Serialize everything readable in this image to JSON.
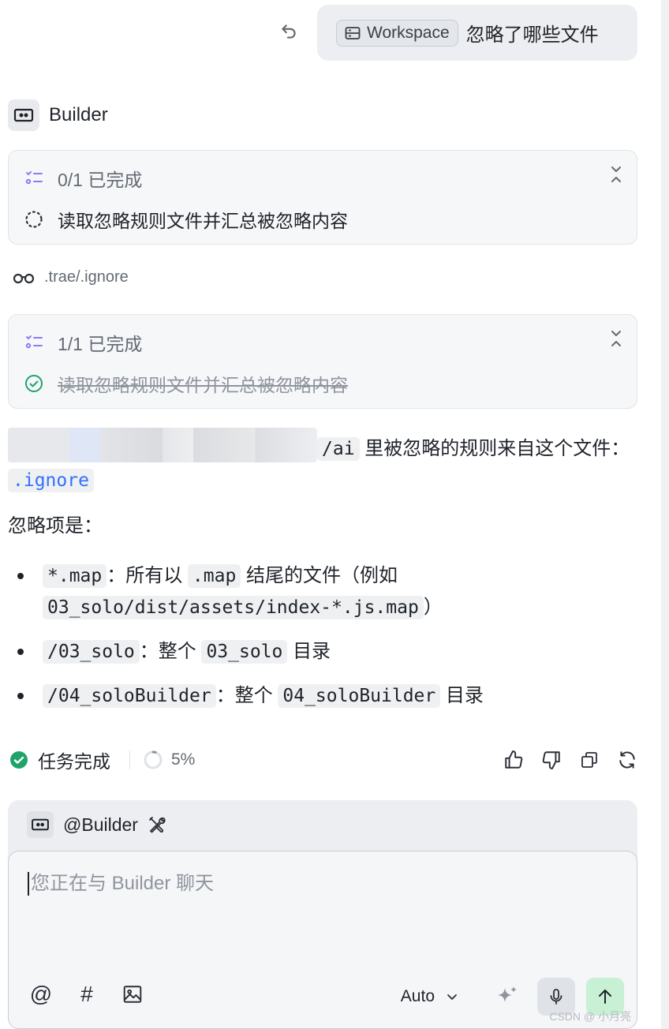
{
  "user_message": {
    "workspace_chip": "Workspace",
    "text": "忽略了哪些文件"
  },
  "agent": {
    "name": "Builder"
  },
  "task_card_1": {
    "progress": "0/1 已完成",
    "item": "读取忽略规则文件并汇总被忽略内容"
  },
  "file_ref": ".trae/.ignore",
  "task_card_2": {
    "progress": "1/1 已完成",
    "item": "读取忽略规则文件并汇总被忽略内容"
  },
  "answer": {
    "path_tail": "/ai",
    "line1_rest": " 里被忽略的规则来自这个文件：",
    "ignore_file": ".ignore",
    "intro": "忽略项是：",
    "bullets": [
      {
        "code": "*.map",
        "text": "：所有以",
        "code2": ".map",
        "text2": "结尾的文件（例如",
        "code3": "03_solo/dist/assets/index-*.js.map",
        "text3": "）"
      },
      {
        "code": "/03_solo",
        "text": "：整个",
        "code2": "03_solo",
        "text2": "目录"
      },
      {
        "code": "/04_soloBuilder",
        "text": "：整个",
        "code2": "04_soloBuilder",
        "text2": "目录"
      }
    ]
  },
  "status": {
    "done_label": "任务完成",
    "progress": "5%",
    "progress_value": 0.05
  },
  "input": {
    "mention": "@Builder",
    "placeholder": "您正在与 Builder 聊天",
    "mode": "Auto"
  },
  "watermark": "CSDN @ 小月亮",
  "colors": {
    "accent": "#3370ff",
    "success": "#20a36b",
    "send_bg": "#c7f0d4"
  }
}
